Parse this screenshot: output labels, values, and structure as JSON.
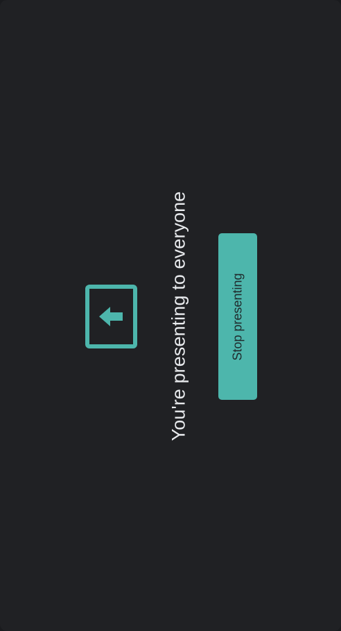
{
  "presenting": {
    "message": "You're presenting to everyone",
    "stop_label": "Stop presenting",
    "icon": "present-to-all-icon"
  },
  "colors": {
    "accent": "#4db6ac",
    "background": "#202124",
    "text": "#e8eaed"
  }
}
